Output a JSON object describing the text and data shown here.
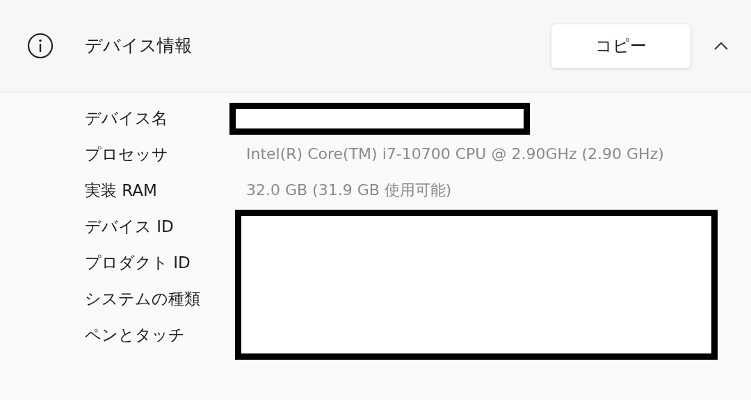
{
  "header": {
    "title": "デバイス情報",
    "copy_button": "コピー",
    "expanded": true
  },
  "details": [
    {
      "label": "デバイス名",
      "redacted": true
    },
    {
      "label": "プロセッサ",
      "redacted": false,
      "value": "Intel(R) Core(TM) i7-10700 CPU @ 2.90GHz (2.90 GHz)"
    },
    {
      "label": "実装 RAM",
      "redacted": false,
      "value": "32.0 GB (31.9 GB 使用可能)"
    },
    {
      "label": "デバイス ID",
      "redacted": true
    },
    {
      "label": "プロダクト ID",
      "redacted": true
    },
    {
      "label": "システムの種類",
      "redacted": true
    },
    {
      "label": "ペンとタッチ",
      "redacted": true
    }
  ]
}
